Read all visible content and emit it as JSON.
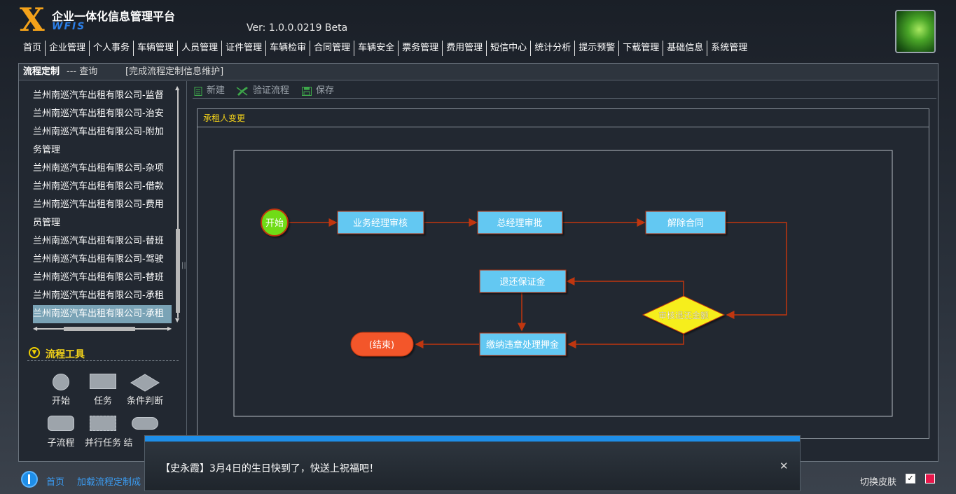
{
  "app": {
    "logo_letter": "X",
    "title": "企业一体化信息管理平台",
    "subtitle": "WFIS",
    "version": "Ver: 1.0.0.0219 Beta"
  },
  "nav": [
    "首页",
    "企业管理",
    "个人事务",
    "车辆管理",
    "人员管理",
    "证件管理",
    "车辆检审",
    "合同管理",
    "车辆安全",
    "票务管理",
    "费用管理",
    "短信中心",
    "统计分析",
    "提示预警",
    "下载管理",
    "基础信息",
    "系统管理"
  ],
  "panel": {
    "title": "流程定制",
    "separator": "--- 查询",
    "desc": "[完成流程定制信息维护]"
  },
  "list": [
    "兰州南巡汽车出租有限公司-监督",
    "兰州南巡汽车出租有限公司-治安",
    "兰州南巡汽车出租有限公司-附加",
    "务管理",
    "兰州南巡汽车出租有限公司-杂项",
    "兰州南巡汽车出租有限公司-借款",
    "兰州南巡汽车出租有限公司-费用",
    "员管理",
    "兰州南巡汽车出租有限公司-替班",
    "兰州南巡汽车出租有限公司-驾驶",
    "兰州南巡汽车出租有限公司-替班",
    "兰州南巡汽车出租有限公司-承租",
    "兰州南巡汽车出租有限公司-承租"
  ],
  "selected_index": 12,
  "tools": {
    "title": "流程工具",
    "items": [
      "开始",
      "任务",
      "条件判断",
      "子流程",
      "并行任务",
      "结"
    ]
  },
  "toolbar": {
    "new": "新建",
    "validate": "验证流程",
    "save": "保存"
  },
  "canvas": {
    "title": "承租人变更",
    "nodes": {
      "start": "开始",
      "task1": "业务经理审核",
      "task2": "总经理审批",
      "task3": "解除合同",
      "decision": "审核退还金额",
      "task4": "退还保证金",
      "task5": "缴纳违章处理押金",
      "end": "(结束)"
    }
  },
  "footer": {
    "home": "首页",
    "crumb": "加载流程定制成",
    "skin_label": "切换皮肤",
    "skin_checked": "✓"
  },
  "notification": {
    "text": "【史永霞】3月4日的生日快到了，快送上祝福吧！",
    "close": "✕"
  },
  "colors": {
    "accent_yellow": "#f3d21a",
    "task_fill": "#64c8f2",
    "start_fill": "#6fdc16",
    "end_fill": "#f3562a",
    "decision_fill": "#f6ee1a",
    "connector": "#c0360f",
    "link_blue": "#3b9cf2"
  }
}
